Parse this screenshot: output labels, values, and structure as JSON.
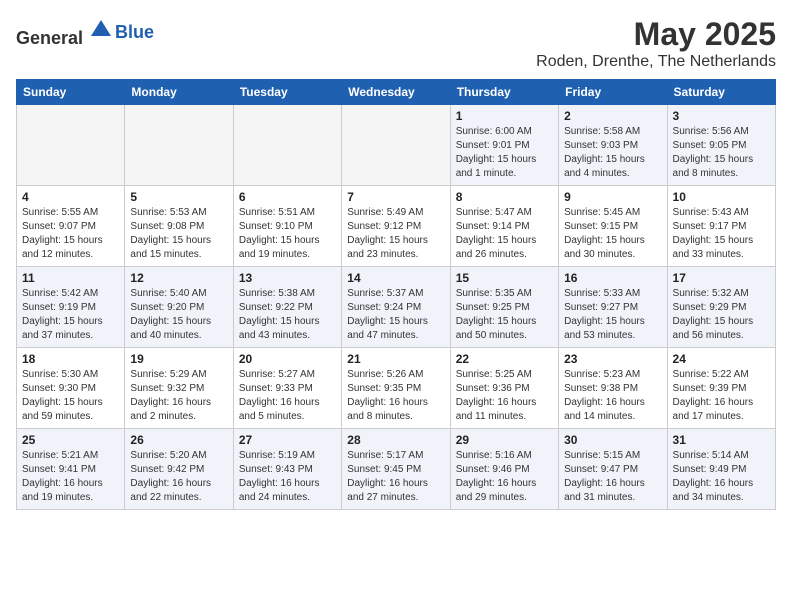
{
  "header": {
    "logo_general": "General",
    "logo_blue": "Blue",
    "month": "May 2025",
    "location": "Roden, Drenthe, The Netherlands"
  },
  "weekdays": [
    "Sunday",
    "Monday",
    "Tuesday",
    "Wednesday",
    "Thursday",
    "Friday",
    "Saturday"
  ],
  "weeks": [
    [
      {
        "day": "",
        "info": ""
      },
      {
        "day": "",
        "info": ""
      },
      {
        "day": "",
        "info": ""
      },
      {
        "day": "",
        "info": ""
      },
      {
        "day": "1",
        "info": "Sunrise: 6:00 AM\nSunset: 9:01 PM\nDaylight: 15 hours\nand 1 minute."
      },
      {
        "day": "2",
        "info": "Sunrise: 5:58 AM\nSunset: 9:03 PM\nDaylight: 15 hours\nand 4 minutes."
      },
      {
        "day": "3",
        "info": "Sunrise: 5:56 AM\nSunset: 9:05 PM\nDaylight: 15 hours\nand 8 minutes."
      }
    ],
    [
      {
        "day": "4",
        "info": "Sunrise: 5:55 AM\nSunset: 9:07 PM\nDaylight: 15 hours\nand 12 minutes."
      },
      {
        "day": "5",
        "info": "Sunrise: 5:53 AM\nSunset: 9:08 PM\nDaylight: 15 hours\nand 15 minutes."
      },
      {
        "day": "6",
        "info": "Sunrise: 5:51 AM\nSunset: 9:10 PM\nDaylight: 15 hours\nand 19 minutes."
      },
      {
        "day": "7",
        "info": "Sunrise: 5:49 AM\nSunset: 9:12 PM\nDaylight: 15 hours\nand 23 minutes."
      },
      {
        "day": "8",
        "info": "Sunrise: 5:47 AM\nSunset: 9:14 PM\nDaylight: 15 hours\nand 26 minutes."
      },
      {
        "day": "9",
        "info": "Sunrise: 5:45 AM\nSunset: 9:15 PM\nDaylight: 15 hours\nand 30 minutes."
      },
      {
        "day": "10",
        "info": "Sunrise: 5:43 AM\nSunset: 9:17 PM\nDaylight: 15 hours\nand 33 minutes."
      }
    ],
    [
      {
        "day": "11",
        "info": "Sunrise: 5:42 AM\nSunset: 9:19 PM\nDaylight: 15 hours\nand 37 minutes."
      },
      {
        "day": "12",
        "info": "Sunrise: 5:40 AM\nSunset: 9:20 PM\nDaylight: 15 hours\nand 40 minutes."
      },
      {
        "day": "13",
        "info": "Sunrise: 5:38 AM\nSunset: 9:22 PM\nDaylight: 15 hours\nand 43 minutes."
      },
      {
        "day": "14",
        "info": "Sunrise: 5:37 AM\nSunset: 9:24 PM\nDaylight: 15 hours\nand 47 minutes."
      },
      {
        "day": "15",
        "info": "Sunrise: 5:35 AM\nSunset: 9:25 PM\nDaylight: 15 hours\nand 50 minutes."
      },
      {
        "day": "16",
        "info": "Sunrise: 5:33 AM\nSunset: 9:27 PM\nDaylight: 15 hours\nand 53 minutes."
      },
      {
        "day": "17",
        "info": "Sunrise: 5:32 AM\nSunset: 9:29 PM\nDaylight: 15 hours\nand 56 minutes."
      }
    ],
    [
      {
        "day": "18",
        "info": "Sunrise: 5:30 AM\nSunset: 9:30 PM\nDaylight: 15 hours\nand 59 minutes."
      },
      {
        "day": "19",
        "info": "Sunrise: 5:29 AM\nSunset: 9:32 PM\nDaylight: 16 hours\nand 2 minutes."
      },
      {
        "day": "20",
        "info": "Sunrise: 5:27 AM\nSunset: 9:33 PM\nDaylight: 16 hours\nand 5 minutes."
      },
      {
        "day": "21",
        "info": "Sunrise: 5:26 AM\nSunset: 9:35 PM\nDaylight: 16 hours\nand 8 minutes."
      },
      {
        "day": "22",
        "info": "Sunrise: 5:25 AM\nSunset: 9:36 PM\nDaylight: 16 hours\nand 11 minutes."
      },
      {
        "day": "23",
        "info": "Sunrise: 5:23 AM\nSunset: 9:38 PM\nDaylight: 16 hours\nand 14 minutes."
      },
      {
        "day": "24",
        "info": "Sunrise: 5:22 AM\nSunset: 9:39 PM\nDaylight: 16 hours\nand 17 minutes."
      }
    ],
    [
      {
        "day": "25",
        "info": "Sunrise: 5:21 AM\nSunset: 9:41 PM\nDaylight: 16 hours\nand 19 minutes."
      },
      {
        "day": "26",
        "info": "Sunrise: 5:20 AM\nSunset: 9:42 PM\nDaylight: 16 hours\nand 22 minutes."
      },
      {
        "day": "27",
        "info": "Sunrise: 5:19 AM\nSunset: 9:43 PM\nDaylight: 16 hours\nand 24 minutes."
      },
      {
        "day": "28",
        "info": "Sunrise: 5:17 AM\nSunset: 9:45 PM\nDaylight: 16 hours\nand 27 minutes."
      },
      {
        "day": "29",
        "info": "Sunrise: 5:16 AM\nSunset: 9:46 PM\nDaylight: 16 hours\nand 29 minutes."
      },
      {
        "day": "30",
        "info": "Sunrise: 5:15 AM\nSunset: 9:47 PM\nDaylight: 16 hours\nand 31 minutes."
      },
      {
        "day": "31",
        "info": "Sunrise: 5:14 AM\nSunset: 9:49 PM\nDaylight: 16 hours\nand 34 minutes."
      }
    ]
  ]
}
